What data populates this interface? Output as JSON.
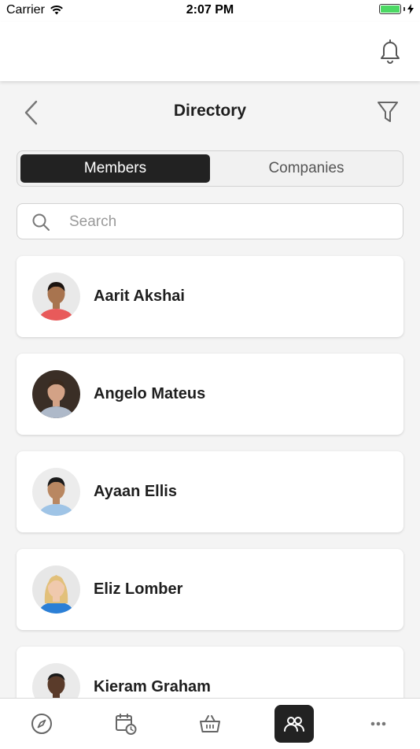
{
  "status_bar": {
    "carrier": "Carrier",
    "time": "2:07 PM"
  },
  "header": {
    "title": "Directory",
    "icons": [
      "bell-icon",
      "back-chevron-icon",
      "filter-icon"
    ]
  },
  "segment": {
    "members_label": "Members",
    "companies_label": "Companies",
    "selected": "Members"
  },
  "search": {
    "placeholder": "Search",
    "value": ""
  },
  "members": [
    {
      "name": "Aarit Akshai",
      "avatar_bg": "#e9e9e9",
      "skin": "#a8744f",
      "hair": "#1c1410",
      "shirt": "#e85a5a"
    },
    {
      "name": "Angelo Mateus",
      "avatar_bg": "#3a2e26",
      "skin": "#d3a286",
      "hair": "#3b2a1e",
      "shirt": "#aeb9c9"
    },
    {
      "name": "Ayaan Ellis",
      "avatar_bg": "#ececec",
      "skin": "#b98761",
      "hair": "#1a1a1a",
      "shirt": "#9fc4e6"
    },
    {
      "name": "Eliz Lomber",
      "avatar_bg": "#e7e7e7",
      "skin": "#f0c9ad",
      "hair": "#e2c07a",
      "shirt": "#2b7fd6"
    },
    {
      "name": "Kieram Graham",
      "avatar_bg": "#eaeaea",
      "skin": "#5a3b2a",
      "hair": "#1a1a1a",
      "shirt": "#8fb8e0"
    }
  ],
  "tab_bar": {
    "tabs": [
      "compass-icon",
      "calendar-clock-icon",
      "basket-icon",
      "people-icon",
      "more-icon"
    ],
    "active": "people-icon"
  },
  "colors": {
    "accent_dark": "#222222",
    "battery_green": "#4cd964",
    "background": "#f4f4f4"
  }
}
